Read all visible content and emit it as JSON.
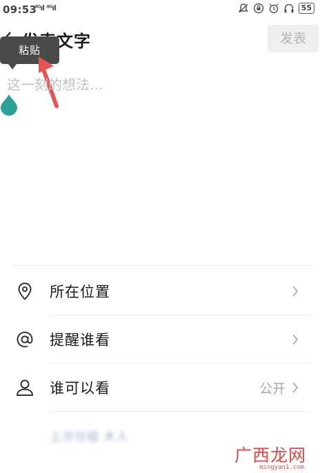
{
  "status_bar": {
    "time": "09:53",
    "signal": "⁴ᴳıl ⁴ᴳıl",
    "battery": "55"
  },
  "header": {
    "title": "发表文字",
    "publish_label": "发表"
  },
  "context_menu": {
    "paste_label": "粘贴"
  },
  "editor": {
    "placeholder": "这一刻的想法..."
  },
  "options": [
    {
      "label": "所在位置",
      "icon": "location-pin-icon",
      "value": ""
    },
    {
      "label": "提醒谁看",
      "icon": "at-sign-icon",
      "value": ""
    },
    {
      "label": "谁可以看",
      "icon": "person-icon",
      "value": "公开"
    }
  ],
  "blurred_text": "上次分组 大人",
  "watermark": {
    "cn": "广西龙网",
    "en": "mingyan1.com"
  },
  "colors": {
    "accent_teal": "#2aa198",
    "arrow_red": "#e45454",
    "publish_bg": "#efefef",
    "popup_bg": "#4a4a4a"
  }
}
